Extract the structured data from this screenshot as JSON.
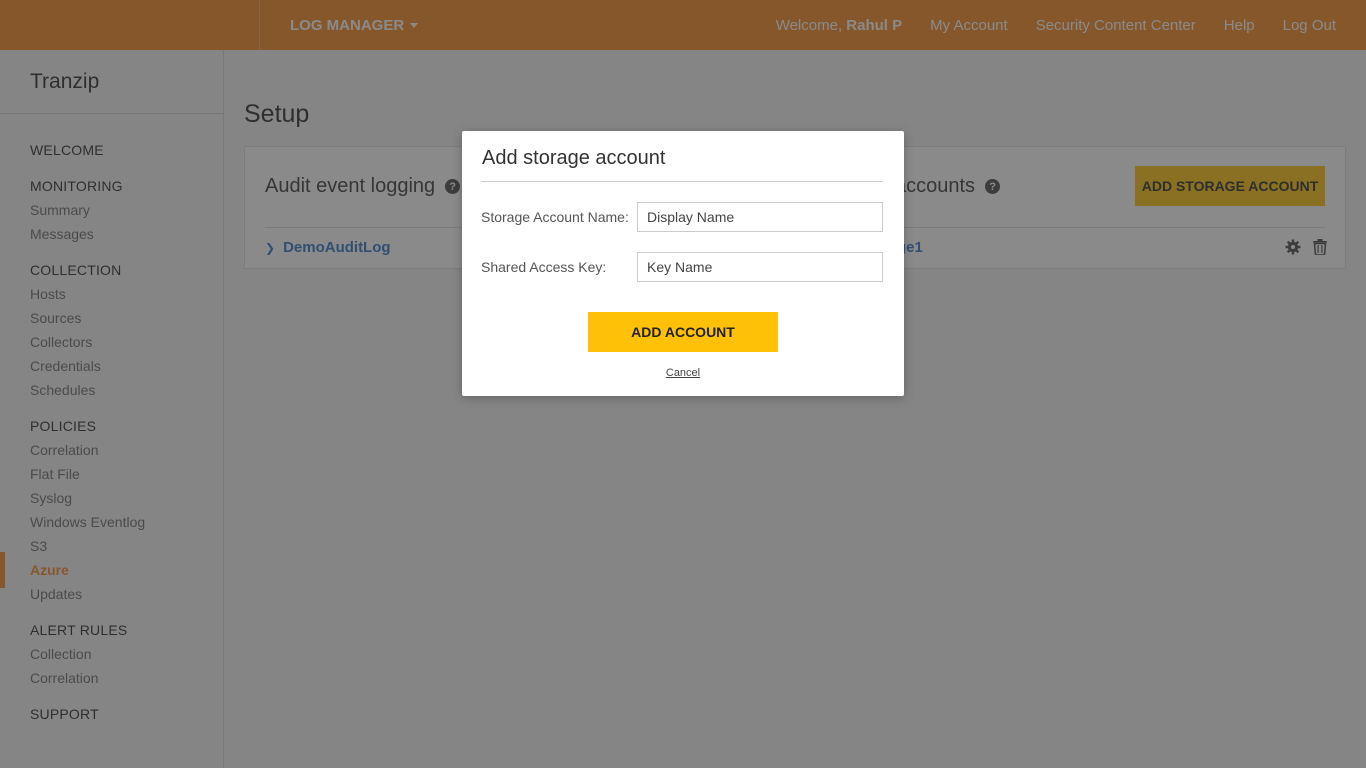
{
  "topbar": {
    "app_menu": "LOG MANAGER",
    "welcome_prefix": "Welcome,",
    "user_name": "Rahul P",
    "links": [
      "My Account",
      "Security Content Center",
      "Help",
      "Log Out"
    ]
  },
  "sidebar": {
    "org": "Tranzip",
    "welcome": "WELCOME",
    "monitoring": {
      "title": "MONITORING",
      "items": [
        "Summary",
        "Messages"
      ]
    },
    "collection": {
      "title": "COLLECTION",
      "items": [
        "Hosts",
        "Sources",
        "Collectors",
        "Credentials",
        "Schedules"
      ]
    },
    "policies": {
      "title": "POLICIES",
      "items": [
        "Correlation",
        "Flat File",
        "Syslog",
        "Windows Eventlog",
        "S3",
        "Azure",
        "Updates"
      ]
    },
    "alert_rules": {
      "title": "ALERT RULES",
      "items": [
        "Collection",
        "Correlation"
      ]
    },
    "support": "SUPPORT"
  },
  "main": {
    "title": "Setup",
    "audit_panel": {
      "title": "Audit event logging",
      "row": "DemoAuditLog"
    },
    "storage_panel": {
      "title": "accounts",
      "button": "ADD STORAGE ACCOUNT",
      "row": "ge1"
    }
  },
  "modal": {
    "title": "Add storage account",
    "name_label": "Storage Account Name:",
    "name_placeholder": "Display Name",
    "key_label": "Shared Access Key:",
    "key_placeholder": "Key Name",
    "add_button": "ADD ACCOUNT",
    "cancel": "Cancel"
  },
  "colors": {
    "brand": "#f7861c",
    "button": "#ffc107",
    "link": "#2a6fc9"
  }
}
